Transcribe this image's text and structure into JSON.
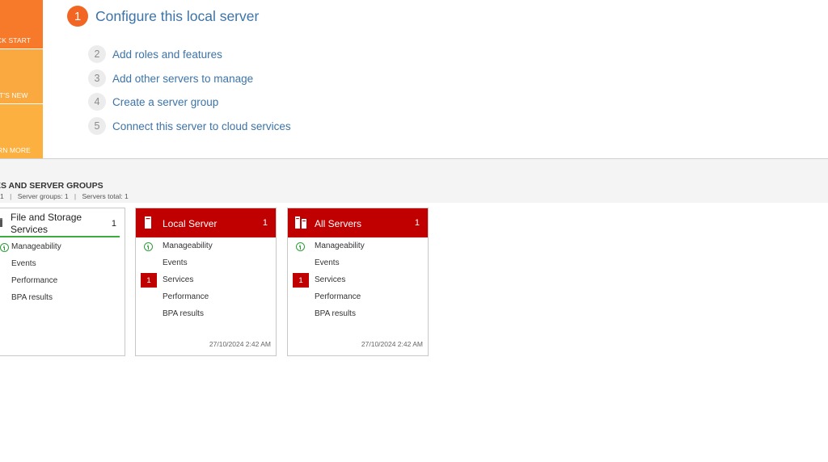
{
  "tiles": {
    "quick_start": "CK START",
    "whats_new": "AT'S NEW",
    "learn_more": "RN MORE"
  },
  "steps": [
    {
      "num": "1",
      "label": "Configure this local server"
    },
    {
      "num": "2",
      "label": "Add roles and features"
    },
    {
      "num": "3",
      "label": "Add other servers to manage"
    },
    {
      "num": "4",
      "label": "Create a server group"
    },
    {
      "num": "5",
      "label": "Connect this server to cloud services"
    }
  ],
  "section": {
    "title": "ES AND SERVER GROUPS",
    "roles_count": "1",
    "server_groups": "Server groups: 1",
    "servers_total": "Servers total: 1",
    "separator": "|"
  },
  "cards": [
    {
      "title": "File and Storage Services",
      "count": "1",
      "rows": [
        "Manageability",
        "Events",
        "Performance",
        "BPA results"
      ]
    },
    {
      "title": "Local Server",
      "count": "1",
      "rows": [
        "Manageability",
        "Events",
        "Services",
        "Performance",
        "BPA results"
      ],
      "services_badge": "1",
      "timestamp": "27/10/2024 2:42 AM"
    },
    {
      "title": "All Servers",
      "count": "1",
      "rows": [
        "Manageability",
        "Events",
        "Services",
        "Performance",
        "BPA results"
      ],
      "services_badge": "1",
      "timestamp": "27/10/2024 2:42 AM"
    }
  ],
  "colors": {
    "accent_orange": "#f26522",
    "card_red": "#c00000",
    "status_green": "#2f9e3a",
    "link_blue": "#3c73a8"
  }
}
